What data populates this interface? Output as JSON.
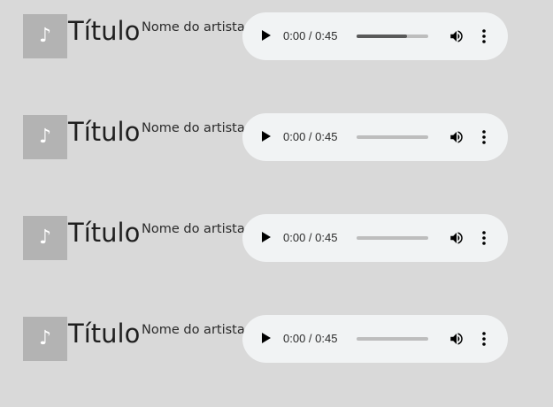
{
  "tracks": [
    {
      "cover_icon": "music-note-icon",
      "cover_glyph": "♪",
      "title": "Título",
      "artist": "Nome do artista",
      "player": {
        "time": "0:00 / 0:45",
        "progress": 0.7,
        "play_icon": "play-icon",
        "volume_icon": "volume-icon",
        "menu_icon": "more-vert-icon"
      }
    },
    {
      "cover_icon": "music-note-icon",
      "cover_glyph": "♪",
      "title": "Título",
      "artist": "Nome do artista",
      "player": {
        "time": "0:00 / 0:45",
        "progress": 0,
        "play_icon": "play-icon",
        "volume_icon": "volume-icon",
        "menu_icon": "more-vert-icon"
      }
    },
    {
      "cover_icon": "music-note-icon",
      "cover_glyph": "♪",
      "title": "Título",
      "artist": "Nome do artista",
      "player": {
        "time": "0:00 / 0:45",
        "progress": 0,
        "play_icon": "play-icon",
        "volume_icon": "volume-icon",
        "menu_icon": "more-vert-icon"
      }
    },
    {
      "cover_icon": "music-note-icon",
      "cover_glyph": "♪",
      "title": "Título",
      "artist": "Nome do artista",
      "player": {
        "time": "0:00 / 0:45",
        "progress": 0,
        "play_icon": "play-icon",
        "volume_icon": "volume-icon",
        "menu_icon": "more-vert-icon"
      }
    }
  ]
}
